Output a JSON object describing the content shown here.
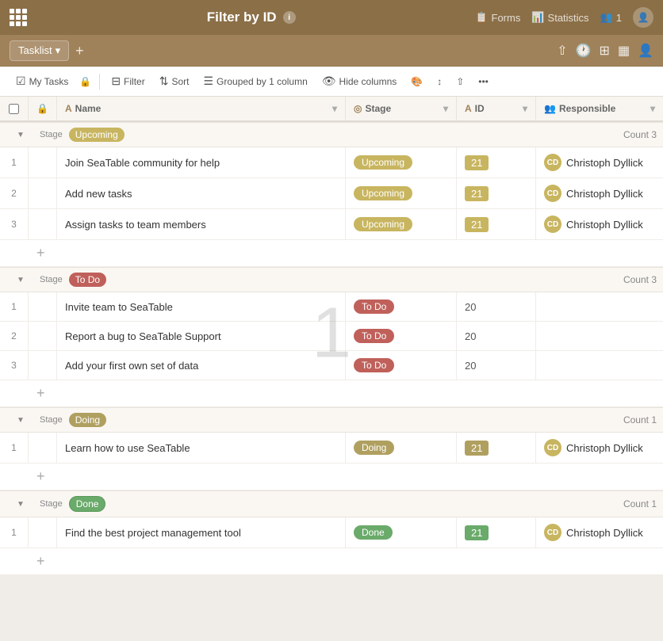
{
  "header": {
    "app_icon": "grid",
    "title": "Filter by ID",
    "info_tooltip": "info",
    "nav": [
      {
        "label": "Forms",
        "icon": "📋"
      },
      {
        "label": "Statistics",
        "icon": "📊"
      },
      {
        "label": "1",
        "icon": "👥"
      }
    ]
  },
  "toolbar": {
    "view_label": "Tasklist",
    "view_dropdown": "▾",
    "add_view_icon": "+",
    "right_icons": [
      "share",
      "history",
      "settings",
      "grid-view",
      "user-view"
    ]
  },
  "sub_toolbar": {
    "my_tasks_label": "My Tasks",
    "filter_label": "Filter",
    "sort_label": "Sort",
    "group_label": "Grouped by 1 column",
    "hide_label": "Hide columns",
    "more_items": [
      "color",
      "row-height",
      "share",
      "more"
    ]
  },
  "columns": [
    {
      "key": "checkbox",
      "label": ""
    },
    {
      "key": "lock",
      "label": "🔒"
    },
    {
      "key": "name",
      "label": "Name"
    },
    {
      "key": "stage",
      "label": "Stage"
    },
    {
      "key": "id",
      "label": "ID"
    },
    {
      "key": "responsible",
      "label": "Responsible"
    }
  ],
  "groups": [
    {
      "key": "upcoming",
      "stage_label": "Upcoming",
      "badge_class": "badge-upcoming",
      "count": 3,
      "rows": [
        {
          "num": 1,
          "name": "Join SeaTable community for help",
          "stage": "Upcoming",
          "stage_class": "badge-upcoming",
          "id": "21",
          "id_colored": true,
          "responsible": "Christoph Dyllick"
        },
        {
          "num": 2,
          "name": "Add new tasks",
          "stage": "Upcoming",
          "stage_class": "badge-upcoming",
          "id": "21",
          "id_colored": true,
          "responsible": "Christoph Dyllick"
        },
        {
          "num": 3,
          "name": "Assign tasks to team members",
          "stage": "Upcoming",
          "stage_class": "badge-upcoming",
          "id": "21",
          "id_colored": true,
          "responsible": "Christoph Dyllick"
        }
      ]
    },
    {
      "key": "todo",
      "stage_label": "To Do",
      "badge_class": "badge-todo",
      "count": 3,
      "rows": [
        {
          "num": 1,
          "name": "Invite team to SeaTable",
          "stage": "To Do",
          "stage_class": "badge-todo",
          "id": "20",
          "id_colored": false,
          "responsible": ""
        },
        {
          "num": 2,
          "name": "Report a bug to SeaTable Support",
          "stage": "To Do",
          "stage_class": "badge-todo",
          "id": "20",
          "id_colored": false,
          "responsible": ""
        },
        {
          "num": 3,
          "name": "Add your first own set of data",
          "stage": "To Do",
          "stage_class": "badge-todo",
          "id": "20",
          "id_colored": false,
          "responsible": ""
        }
      ]
    },
    {
      "key": "doing",
      "stage_label": "Doing",
      "badge_class": "badge-doing",
      "count": 1,
      "rows": [
        {
          "num": 1,
          "name": "Learn how to use SeaTable",
          "stage": "Doing",
          "stage_class": "badge-upcoming",
          "id": "21",
          "id_colored": true,
          "responsible": "Christoph Dyllick"
        }
      ]
    },
    {
      "key": "done",
      "stage_label": "Done",
      "badge_class": "badge-done",
      "count": 1,
      "rows": [
        {
          "num": 1,
          "name": "Find the best project management tool",
          "stage": "Done",
          "stage_class": "badge-done",
          "id": "21",
          "id_colored": true,
          "responsible": "Christoph Dyllick"
        }
      ]
    }
  ],
  "big_number": "1",
  "add_row_label": "+"
}
